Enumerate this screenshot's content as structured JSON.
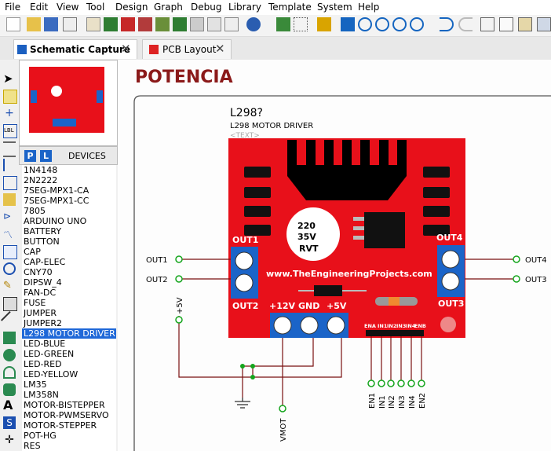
{
  "menu": [
    "File",
    "Edit",
    "View",
    "Tool",
    "Design",
    "Graph",
    "Debug",
    "Library",
    "Template",
    "System",
    "Help"
  ],
  "tabs": [
    {
      "label": "Schematic Capture",
      "active": true
    },
    {
      "label": "PCB Layout",
      "active": false
    }
  ],
  "devices": {
    "header": "DEVICES",
    "p_button": "P",
    "l_button": "L",
    "items": [
      "1N4148",
      "2N2222",
      "7SEG-MPX1-CA",
      "7SEG-MPX1-CC",
      "7805",
      "ARDUINO UNO",
      "BATTERY",
      "BUTTON",
      "CAP",
      "CAP-ELEC",
      "CNY70",
      "DIPSW_4",
      "FAN-DC",
      "FUSE",
      "JUMPER",
      "JUMPER2",
      "L298 MOTOR DRIVER",
      "LED-BLUE",
      "LED-GREEN",
      "LED-RED",
      "LED-YELLOW",
      "LM35",
      "LM358N",
      "MOTOR-BISTEPPER",
      "MOTOR-PWMSERVO",
      "MOTOR-STEPPER",
      "POT-HG",
      "RES"
    ],
    "selected": "L298 MOTOR DRIVER"
  },
  "schematic": {
    "sheet_title": "POTENCIA",
    "ref": "L298?",
    "part_name": "L298 MOTOR DRIVER",
    "text_placeholder": "<TEXT>",
    "cap_label": [
      "220",
      "35V",
      "RVT"
    ],
    "website": "www.TheEngineeringProjects.com",
    "out1": "OUT1",
    "out2": "OUT2",
    "out3": "OUT3",
    "out4": "OUT4",
    "v12": "+12V",
    "gnd": "GND",
    "v5": "+5V",
    "pins": [
      "ENA",
      "IN1",
      "IN2",
      "IN3",
      "IN4",
      "ENB"
    ],
    "left_terms": [
      "OUT1",
      "OUT2"
    ],
    "right_terms": [
      "OUT4",
      "OUT3"
    ],
    "bottom_terms": [
      "EN1",
      "IN1",
      "IN2",
      "IN3",
      "IN4",
      "EN2"
    ],
    "vmot": "VMOT",
    "plus5": "+5V"
  },
  "colors": {
    "board": "#e8101a",
    "accent": "#1b64c8",
    "wire": "#7a1010",
    "terminal": "#15a51d"
  }
}
